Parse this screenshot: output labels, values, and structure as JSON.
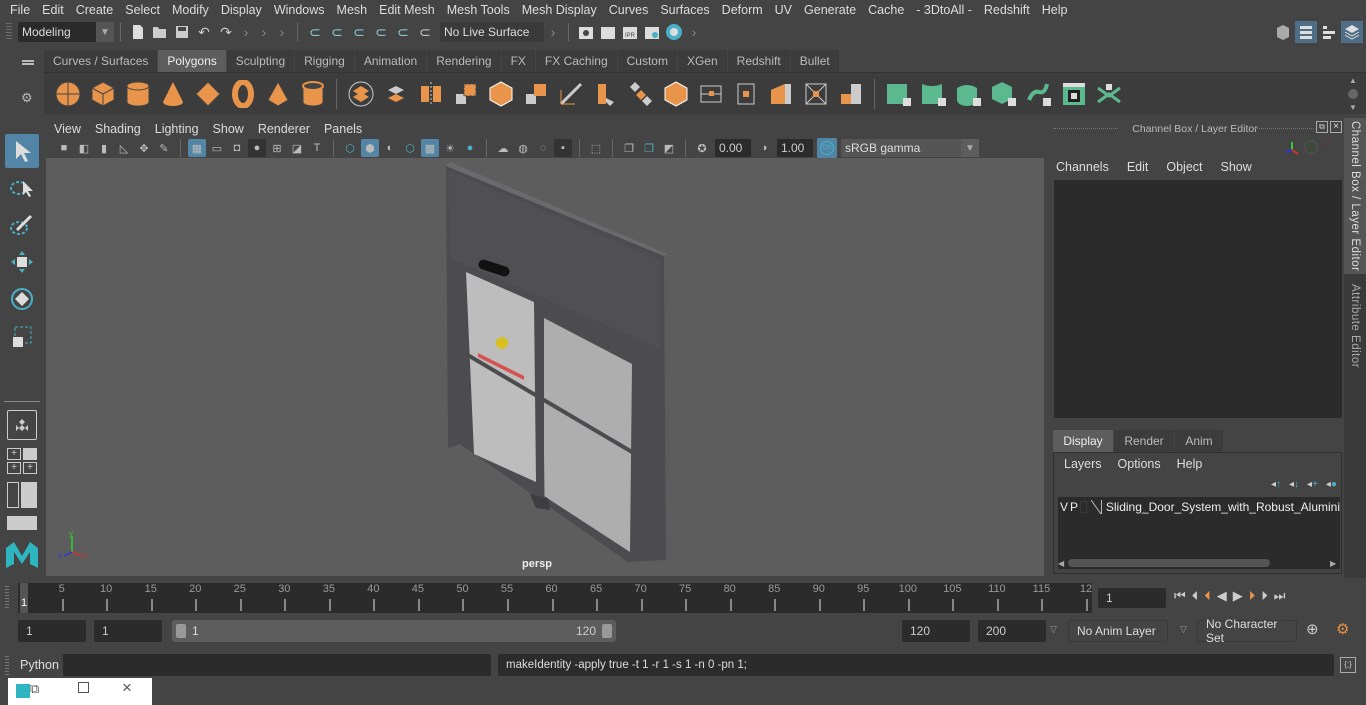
{
  "menubar": [
    "File",
    "Edit",
    "Create",
    "Select",
    "Modify",
    "Display",
    "Windows",
    "Mesh",
    "Edit Mesh",
    "Mesh Tools",
    "Mesh Display",
    "Curves",
    "Surfaces",
    "Deform",
    "UV",
    "Generate",
    "Cache",
    "- 3DtoAll -",
    "Redshift",
    "Help"
  ],
  "statusline": {
    "workspace": "Modeling",
    "live_surface": "No Live Surface"
  },
  "shelf": {
    "tabs": [
      "Curves / Surfaces",
      "Polygons",
      "Sculpting",
      "Rigging",
      "Animation",
      "Rendering",
      "FX",
      "FX Caching",
      "Custom",
      "XGen",
      "Redshift",
      "Bullet"
    ],
    "active_tab": "Polygons",
    "accent_orange": "#e8944a",
    "accent_green": "#5cb88f"
  },
  "viewport": {
    "menu": [
      "View",
      "Shading",
      "Lighting",
      "Show",
      "Renderer",
      "Panels"
    ],
    "exposure": "0.00",
    "gamma": "1.00",
    "color_space_toggle": "ON",
    "color_space": "sRGB gamma",
    "camera_label": "persp",
    "axis": {
      "x": "x",
      "y": "y",
      "z": "z"
    }
  },
  "channel_box": {
    "title": "Channel Box / Layer Editor",
    "menu": [
      "Channels",
      "Edit",
      "Object",
      "Show"
    ],
    "layer_tabs": [
      "Display",
      "Render",
      "Anim"
    ],
    "active_layer_tab": "Display",
    "layer_menu": [
      "Layers",
      "Options",
      "Help"
    ],
    "layers": [
      {
        "v": "V",
        "p": "P",
        "name": "Sliding_Door_System_with_Robust_Alumini"
      }
    ]
  },
  "side_tabs": [
    "Channel Box / Layer Editor",
    "Attribute Editor"
  ],
  "timeline": {
    "ticks": [
      5,
      10,
      15,
      20,
      25,
      30,
      35,
      40,
      45,
      50,
      55,
      60,
      65,
      70,
      75,
      80,
      85,
      90,
      95,
      100,
      105,
      110,
      115,
      "12"
    ],
    "current_frame_marker": "1",
    "current_frame": "1",
    "min": 1,
    "max": 120
  },
  "range": {
    "start": "1",
    "playback_start": "1",
    "slider_start": "1",
    "slider_end": "120",
    "playback_end": "120",
    "end": "200",
    "anim_layer": "No Anim Layer",
    "character_set": "No Character Set"
  },
  "command": {
    "language": "Python",
    "input": "",
    "result": "makeIdentity -apply true -t 1 -r 1 -s 1 -n 0 -pn 1;"
  }
}
